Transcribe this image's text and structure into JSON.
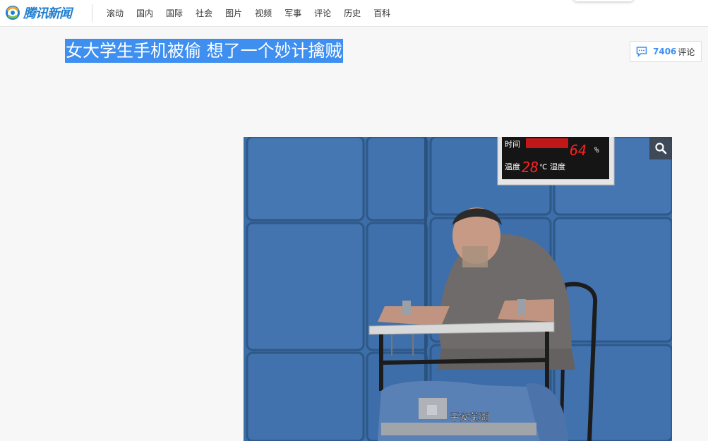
{
  "header": {
    "logo_text": "腾讯新闻",
    "nav": [
      "滚动",
      "国内",
      "国际",
      "社会",
      "图片",
      "视频",
      "军事",
      "评论",
      "历史",
      "百科"
    ]
  },
  "article": {
    "title": "女大学生手机被偷 想了一个妙计擒贼",
    "comment_count": "7406",
    "comment_label": "评论"
  },
  "image": {
    "panel_row1": "时间",
    "panel_row2_label1": "温度",
    "temperature": "28",
    "temp_unit": "℃",
    "panel_row2_label2": "湿度",
    "humidity": "64",
    "humidity_unit": "%",
    "caption": "平安芜湖"
  },
  "colors": {
    "accent": "#3f8ff0",
    "wall": "#3e6fa8",
    "led": "#ff2020"
  }
}
